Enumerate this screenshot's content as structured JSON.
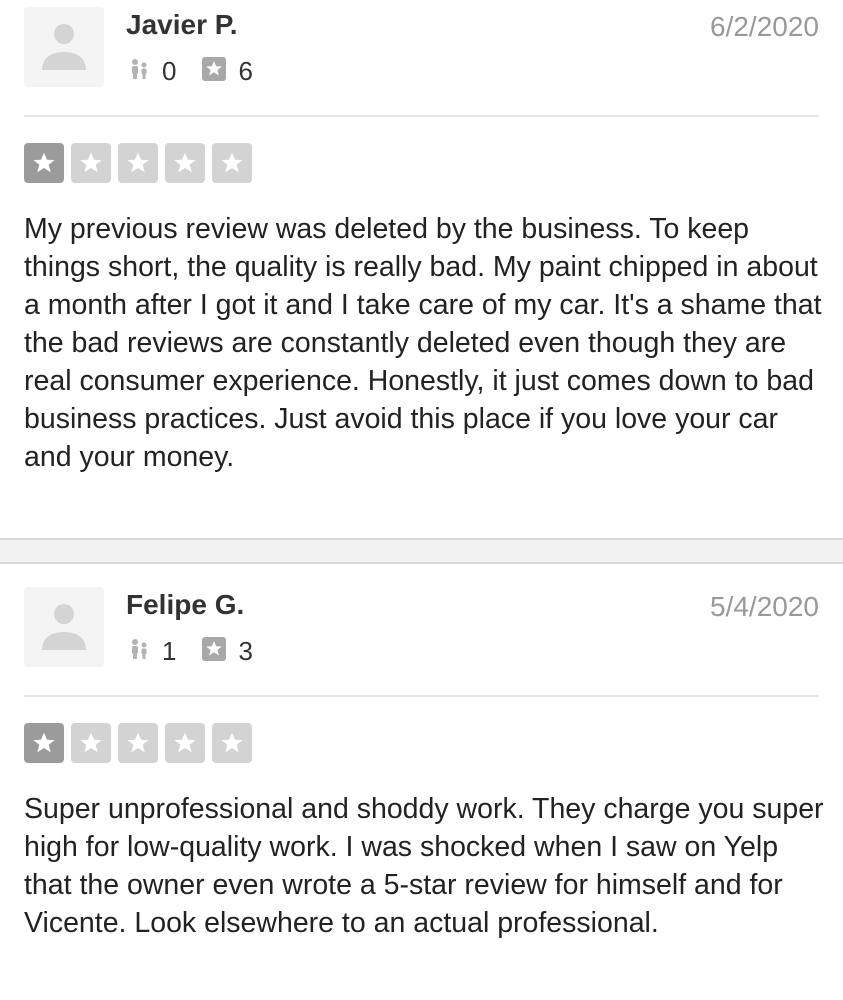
{
  "reviews": [
    {
      "user_name": "Javier P.",
      "date": "6/2/2020",
      "friends_count": "0",
      "reviews_count": "6",
      "rating": 1,
      "rating_max": 5,
      "text": "My previous review was deleted by the business. To keep things short, the quality is really bad. My paint chipped in about a month after I got it and I take care of my car. It's a shame that the bad reviews are constantly deleted even though they are real consumer experience. Honestly, it just comes down to bad business practices. Just avoid this place if you love your car and your money."
    },
    {
      "user_name": "Felipe G.",
      "date": "5/4/2020",
      "friends_count": "1",
      "reviews_count": "3",
      "rating": 1,
      "rating_max": 5,
      "text": "Super unprofessional and shoddy work. They charge you super high for low-quality work. I was shocked when I saw on Yelp that the owner even wrote a 5-star review for himself and for Vicente. Look elsewhere to an actual professional."
    }
  ],
  "colors": {
    "star_filled": "#9b9b9b",
    "star_empty": "#d3d3d3",
    "date_text": "#999999",
    "avatar_bg": "#f4f4f4"
  },
  "icons": {
    "avatar": "default-user-avatar-icon",
    "friends": "friends-icon",
    "reviews": "review-star-icon",
    "star": "star-icon"
  }
}
